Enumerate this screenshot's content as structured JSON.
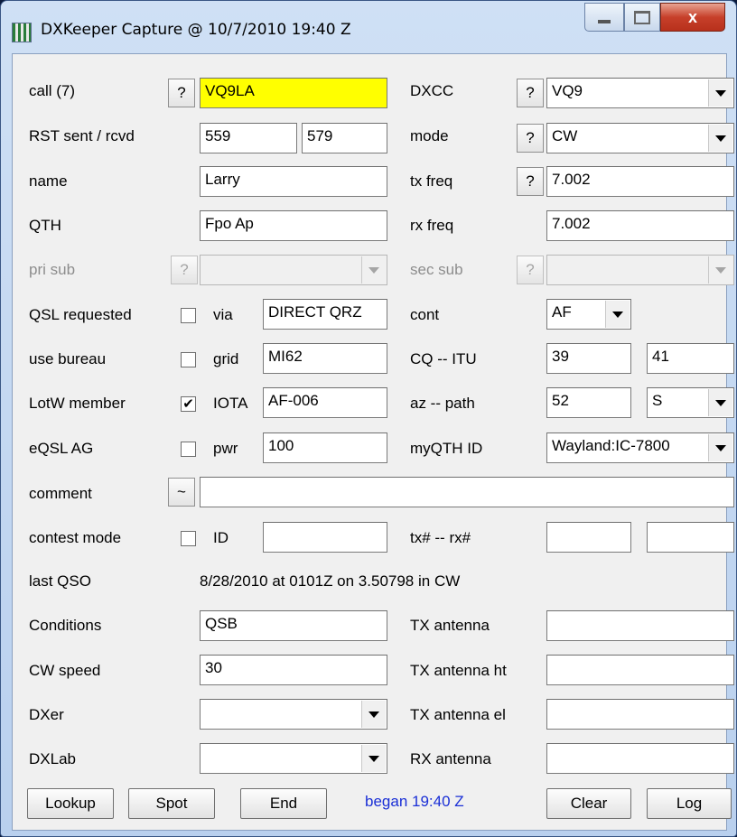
{
  "window": {
    "title": "DXKeeper Capture @ 10/7/2010   19:40 Z",
    "close_glyph": "x"
  },
  "left": {
    "call_label": "call (7)",
    "call_value": "VQ9LA",
    "rst_label": "RST sent / rcvd",
    "rst_sent": "559",
    "rst_rcvd": "579",
    "name_label": "name",
    "name_value": "Larry",
    "qth_label": "QTH",
    "qth_value": "Fpo Ap",
    "prisub_label": "pri sub",
    "prisub_value": "",
    "qslreq_label": "QSL requested",
    "qslreq_checked": false,
    "via_label": "via",
    "via_value": "DIRECT QRZ",
    "bureau_label": "use bureau",
    "bureau_checked": false,
    "grid_label": "grid",
    "grid_value": "MI62",
    "lotw_label": "LotW member",
    "lotw_checked": true,
    "iota_label": "IOTA",
    "iota_value": "AF-006",
    "eqsl_label": "eQSL AG",
    "eqsl_checked": false,
    "pwr_label": "pwr",
    "pwr_value": "100",
    "comment_label": "comment",
    "comment_btn": "~",
    "comment_value": "",
    "contest_label": "contest mode",
    "contest_checked": false,
    "id_label": "ID",
    "id_value": "",
    "lastqso_label": "last QSO",
    "lastqso_value": "8/28/2010 at 0101Z on 3.50798 in CW",
    "conditions_label": "Conditions",
    "conditions_value": "QSB",
    "cwspeed_label": "CW  speed",
    "cwspeed_value": "30",
    "dxer_label": "DXer",
    "dxer_value": "",
    "dxlab_label": "DXLab",
    "dxlab_value": ""
  },
  "right": {
    "dxcc_label": "DXCC",
    "dxcc_value": "VQ9",
    "mode_label": "mode",
    "mode_value": "CW",
    "txfreq_label": "tx freq",
    "txfreq_value": "7.002",
    "rxfreq_label": "rx freq",
    "rxfreq_value": "7.002",
    "secsub_label": "sec sub",
    "secsub_value": "",
    "cont_label": "cont",
    "cont_value": "AF",
    "cqitu_label": "CQ  -- ITU",
    "cq_value": "39",
    "itu_value": "41",
    "azpath_label": "az  -- path",
    "az_value": "52",
    "path_value": "S",
    "myqth_label": "myQTH ID",
    "myqth_value": "Wayland:IC-7800",
    "txrx_label": "tx#  -- rx#",
    "tx_num": "",
    "rx_num": "",
    "txant_label": "TX antenna",
    "txant_value": "",
    "txantht_label": "TX antenna ht",
    "txantht_value": "",
    "txantel_label": "TX antenna el",
    "txantel_value": "",
    "rxant_label": "RX antenna",
    "rxant_value": ""
  },
  "help_glyph": "?",
  "check_glyph": "✔",
  "buttons": {
    "lookup": "Lookup",
    "spot": "Spot",
    "end": "End",
    "began": "began 19:40 Z",
    "clear": "Clear",
    "log": "Log"
  },
  "colors": {
    "call_highlight": "#ffff00",
    "began_text": "#1a2fd6"
  }
}
